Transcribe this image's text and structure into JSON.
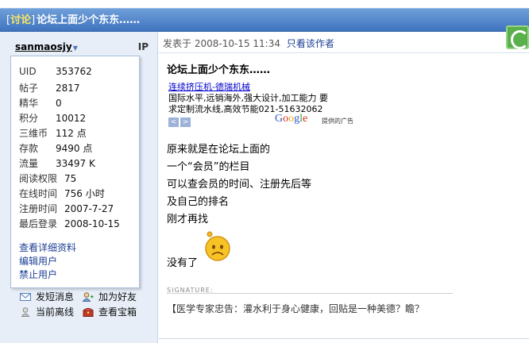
{
  "thread": {
    "bracket_open": "[",
    "tag": "讨论",
    "bracket_close": "]",
    "title": "论坛上面少个东东……"
  },
  "user": {
    "name": "sanmaosjy",
    "ip_label": "IP",
    "stats": [
      {
        "label": "UID",
        "value": "353762"
      },
      {
        "label": "帖子",
        "value": "2817"
      },
      {
        "label": "精华",
        "value": "0"
      },
      {
        "label": "积分",
        "value": "10012"
      },
      {
        "label": "三维币",
        "value": "112 点"
      },
      {
        "label": "存款",
        "value": "9490 点"
      },
      {
        "label": "流量",
        "value": "33497 K"
      },
      {
        "label": "阅读权限",
        "value": "75"
      },
      {
        "label": "在线时间",
        "value": "756 小时"
      },
      {
        "label": "注册时间",
        "value": "2007-7-27"
      },
      {
        "label": "最后登录",
        "value": "2008-10-15"
      }
    ],
    "links": [
      "查看详细资料",
      "编辑用户",
      "禁止用户"
    ],
    "actions": {
      "send_message": "发短消息",
      "add_friend": "加为好友",
      "offline_status": "当前离线",
      "view_treasure": "查看宝箱"
    }
  },
  "post": {
    "posted_prefix": "发表于",
    "posted_time": "2008-10-15 11:34",
    "author_only": "只看该作者",
    "title": "论坛上面少个东东……",
    "lines": [
      "原来就是在论坛上面的",
      "一个“会员”的栏目",
      "可以查会员的时间、注册先后等",
      "及自己的排名",
      "刚才再找",
      "没有了"
    ]
  },
  "ad": {
    "link_text": "连续挤压机-德瑞机械",
    "line1": "国际水平,远销海外,强大设计,加工能力 要",
    "line2": "求定制流水线,高效节能021-51632062",
    "prev": "<",
    "next": ">",
    "google": "Google",
    "provided": "提供的广告"
  },
  "signature": {
    "label": "SIGNATURE:",
    "text": "【医学专家忠告：灌水利于身心健康，回贴是一种美德？瞻？"
  },
  "colors": {
    "title_bar": "#3f74bf",
    "tag": "#ffe860",
    "link": "#1c3f95",
    "sidebar_bg": "#e7eef8"
  },
  "icons": [
    "message-icon",
    "add-friend-icon",
    "offline-icon",
    "treasure-icon",
    "sad-smiley-icon",
    "tool-icon"
  ]
}
